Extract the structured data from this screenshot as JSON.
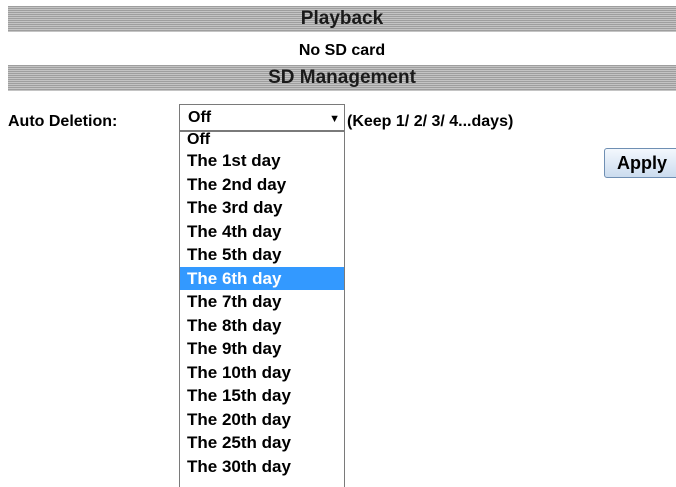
{
  "playback": {
    "title": "Playback",
    "status": "No SD card"
  },
  "sd_management": {
    "title": "SD Management",
    "auto_deletion": {
      "label": "Auto Deletion:",
      "selected_value": "Off",
      "hint": "(Keep 1/ 2/ 3/ 4...days)",
      "highlighted_option": "The 6th day",
      "options": [
        "Off",
        "The 1st day",
        "The 2nd day",
        "The 3rd day",
        "The 4th day",
        "The 5th day",
        "The 6th day",
        "The 7th day",
        "The 8th day",
        "The 9th day",
        "The 10th day",
        "The 15th day",
        "The 20th day",
        "The 25th day",
        "The 30th day"
      ]
    },
    "apply_label": "Apply"
  },
  "icons": {
    "dropdown_arrow": "chevron-down-icon"
  },
  "colors": {
    "highlight": "#3399ff",
    "header_dark": "#9e9e9e",
    "header_light": "#c4c4c4"
  }
}
